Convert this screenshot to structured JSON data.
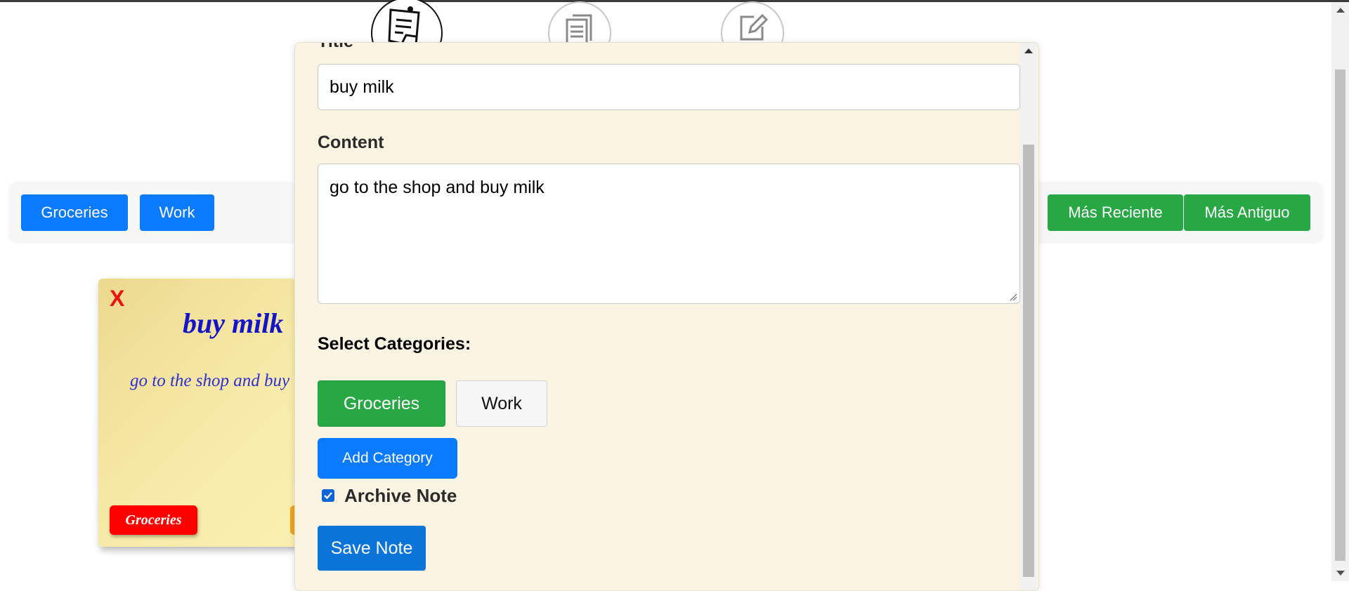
{
  "filters": {
    "categories": [
      "Groceries",
      "Work"
    ],
    "sort_recent": "Más Reciente",
    "sort_oldest": "Más Antiguo"
  },
  "note_card": {
    "close_label": "X",
    "title": "buy milk",
    "content": "go to the shop and buy milk",
    "tag": "Groceries",
    "tag_color": "#ff0000"
  },
  "form": {
    "title_label": "Title",
    "title_value": "buy milk",
    "content_label": "Content",
    "content_value": "go to the shop and buy milk",
    "categories_label": "Select Categories:",
    "categories": [
      {
        "label": "Groceries",
        "selected": true
      },
      {
        "label": "Work",
        "selected": false
      }
    ],
    "add_category_label": "Add Category",
    "archive_label": "Archive Note",
    "archive_checked": true,
    "save_label": "Save Note"
  },
  "nav": {
    "icons": [
      "notes-icon",
      "archive-icon",
      "edit-icon"
    ]
  },
  "colors": {
    "primary_blue": "#0a7bff",
    "success_green": "#28a745",
    "modal_bg": "#fbf4e2",
    "note_title": "#1313c9",
    "close_red": "#ee1111"
  }
}
